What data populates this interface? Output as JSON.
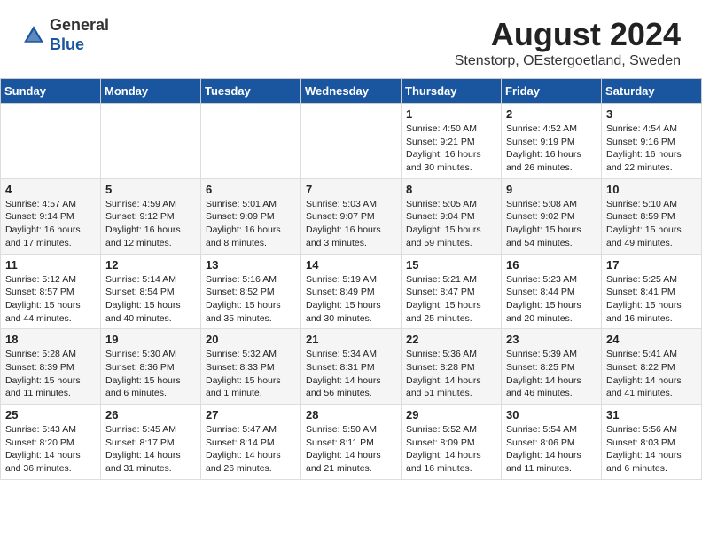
{
  "header": {
    "logo_general": "General",
    "logo_blue": "Blue",
    "month_title": "August 2024",
    "location": "Stenstorp, OEstergoetland, Sweden"
  },
  "weekdays": [
    "Sunday",
    "Monday",
    "Tuesday",
    "Wednesday",
    "Thursday",
    "Friday",
    "Saturday"
  ],
  "weeks": [
    [
      {
        "day": "",
        "info": ""
      },
      {
        "day": "",
        "info": ""
      },
      {
        "day": "",
        "info": ""
      },
      {
        "day": "",
        "info": ""
      },
      {
        "day": "1",
        "info": "Sunrise: 4:50 AM\nSunset: 9:21 PM\nDaylight: 16 hours\nand 30 minutes."
      },
      {
        "day": "2",
        "info": "Sunrise: 4:52 AM\nSunset: 9:19 PM\nDaylight: 16 hours\nand 26 minutes."
      },
      {
        "day": "3",
        "info": "Sunrise: 4:54 AM\nSunset: 9:16 PM\nDaylight: 16 hours\nand 22 minutes."
      }
    ],
    [
      {
        "day": "4",
        "info": "Sunrise: 4:57 AM\nSunset: 9:14 PM\nDaylight: 16 hours\nand 17 minutes."
      },
      {
        "day": "5",
        "info": "Sunrise: 4:59 AM\nSunset: 9:12 PM\nDaylight: 16 hours\nand 12 minutes."
      },
      {
        "day": "6",
        "info": "Sunrise: 5:01 AM\nSunset: 9:09 PM\nDaylight: 16 hours\nand 8 minutes."
      },
      {
        "day": "7",
        "info": "Sunrise: 5:03 AM\nSunset: 9:07 PM\nDaylight: 16 hours\nand 3 minutes."
      },
      {
        "day": "8",
        "info": "Sunrise: 5:05 AM\nSunset: 9:04 PM\nDaylight: 15 hours\nand 59 minutes."
      },
      {
        "day": "9",
        "info": "Sunrise: 5:08 AM\nSunset: 9:02 PM\nDaylight: 15 hours\nand 54 minutes."
      },
      {
        "day": "10",
        "info": "Sunrise: 5:10 AM\nSunset: 8:59 PM\nDaylight: 15 hours\nand 49 minutes."
      }
    ],
    [
      {
        "day": "11",
        "info": "Sunrise: 5:12 AM\nSunset: 8:57 PM\nDaylight: 15 hours\nand 44 minutes."
      },
      {
        "day": "12",
        "info": "Sunrise: 5:14 AM\nSunset: 8:54 PM\nDaylight: 15 hours\nand 40 minutes."
      },
      {
        "day": "13",
        "info": "Sunrise: 5:16 AM\nSunset: 8:52 PM\nDaylight: 15 hours\nand 35 minutes."
      },
      {
        "day": "14",
        "info": "Sunrise: 5:19 AM\nSunset: 8:49 PM\nDaylight: 15 hours\nand 30 minutes."
      },
      {
        "day": "15",
        "info": "Sunrise: 5:21 AM\nSunset: 8:47 PM\nDaylight: 15 hours\nand 25 minutes."
      },
      {
        "day": "16",
        "info": "Sunrise: 5:23 AM\nSunset: 8:44 PM\nDaylight: 15 hours\nand 20 minutes."
      },
      {
        "day": "17",
        "info": "Sunrise: 5:25 AM\nSunset: 8:41 PM\nDaylight: 15 hours\nand 16 minutes."
      }
    ],
    [
      {
        "day": "18",
        "info": "Sunrise: 5:28 AM\nSunset: 8:39 PM\nDaylight: 15 hours\nand 11 minutes."
      },
      {
        "day": "19",
        "info": "Sunrise: 5:30 AM\nSunset: 8:36 PM\nDaylight: 15 hours\nand 6 minutes."
      },
      {
        "day": "20",
        "info": "Sunrise: 5:32 AM\nSunset: 8:33 PM\nDaylight: 15 hours\nand 1 minute."
      },
      {
        "day": "21",
        "info": "Sunrise: 5:34 AM\nSunset: 8:31 PM\nDaylight: 14 hours\nand 56 minutes."
      },
      {
        "day": "22",
        "info": "Sunrise: 5:36 AM\nSunset: 8:28 PM\nDaylight: 14 hours\nand 51 minutes."
      },
      {
        "day": "23",
        "info": "Sunrise: 5:39 AM\nSunset: 8:25 PM\nDaylight: 14 hours\nand 46 minutes."
      },
      {
        "day": "24",
        "info": "Sunrise: 5:41 AM\nSunset: 8:22 PM\nDaylight: 14 hours\nand 41 minutes."
      }
    ],
    [
      {
        "day": "25",
        "info": "Sunrise: 5:43 AM\nSunset: 8:20 PM\nDaylight: 14 hours\nand 36 minutes."
      },
      {
        "day": "26",
        "info": "Sunrise: 5:45 AM\nSunset: 8:17 PM\nDaylight: 14 hours\nand 31 minutes."
      },
      {
        "day": "27",
        "info": "Sunrise: 5:47 AM\nSunset: 8:14 PM\nDaylight: 14 hours\nand 26 minutes."
      },
      {
        "day": "28",
        "info": "Sunrise: 5:50 AM\nSunset: 8:11 PM\nDaylight: 14 hours\nand 21 minutes."
      },
      {
        "day": "29",
        "info": "Sunrise: 5:52 AM\nSunset: 8:09 PM\nDaylight: 14 hours\nand 16 minutes."
      },
      {
        "day": "30",
        "info": "Sunrise: 5:54 AM\nSunset: 8:06 PM\nDaylight: 14 hours\nand 11 minutes."
      },
      {
        "day": "31",
        "info": "Sunrise: 5:56 AM\nSunset: 8:03 PM\nDaylight: 14 hours\nand 6 minutes."
      }
    ]
  ]
}
